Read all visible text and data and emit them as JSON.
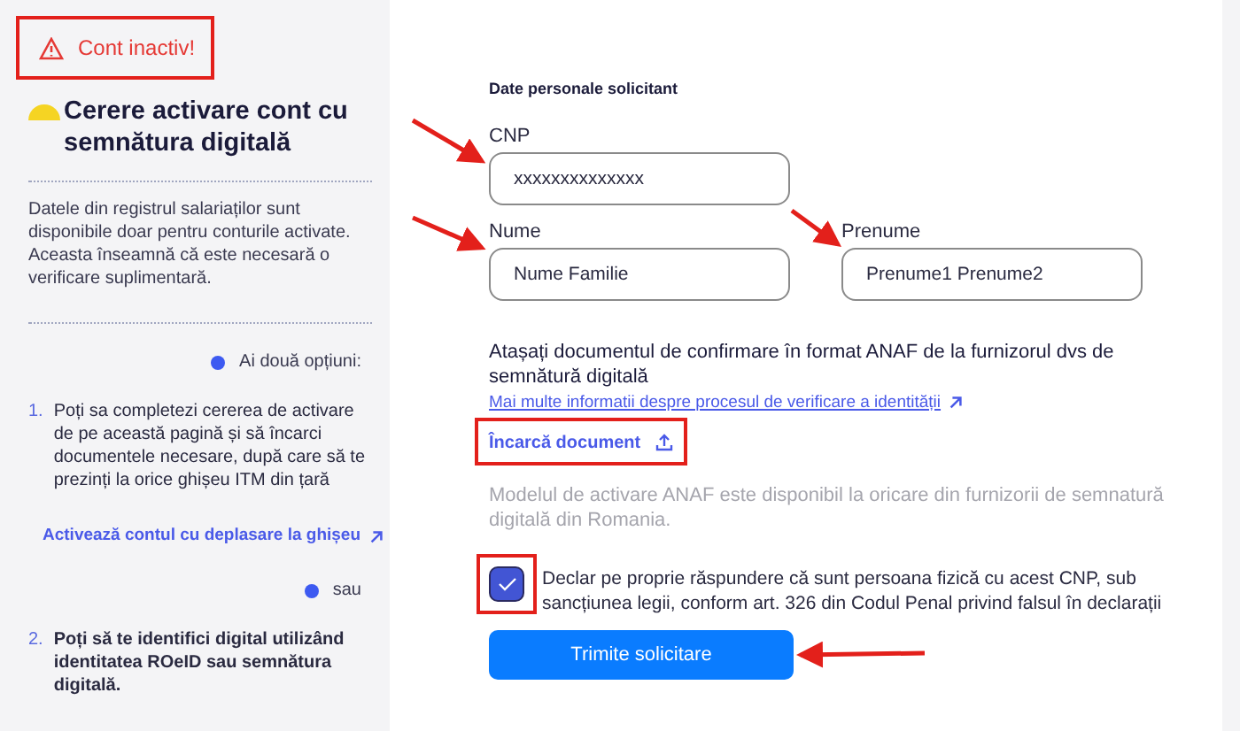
{
  "sidebar": {
    "alert": "Cont inactiv!",
    "title": "Cerere activare cont cu semnătura digitală",
    "intro": "Datele din registrul salariaților sunt disponibile doar pentru conturile activate. Aceasta înseamnă că este necesară o verificare suplimentară.",
    "options_label": "Ai două opțiuni:",
    "option_1": {
      "number": "1.",
      "text": "Poți sa completezi cererea de activare de pe această pagină și să încarci documentele necesare, după care să te prezinți la orice ghișeu ITM din țară"
    },
    "option_link": "Activează contul cu deplasare la ghișeu",
    "separator": "sau",
    "option_2": {
      "number": "2.",
      "text": "Poți să te identifici digital utilizând identitatea ROeID sau semnătura digitală."
    }
  },
  "form": {
    "section_title": "Date personale solicitant",
    "fields": [
      {
        "label": "CNP",
        "value": "xxxxxxxxxxxxxx"
      },
      {
        "label": "Nume",
        "value": "Nume Familie"
      },
      {
        "label": "Prenume",
        "value": "Prenume1 Prenume2"
      }
    ],
    "attach_text": "Atașați documentul de confirmare în format ANAF de la furnizorul dvs de semnătură digitală",
    "info_link": "Mai multe informatii despre procesul de verificare a identității",
    "upload": "Încarcă document",
    "note": "Modelul de activare ANAF este disponibil la oricare din furnizorii de semnatură digitală din Romania.",
    "declaration": {
      "checked": true,
      "text": "Declar pe proprie răspundere că sunt persoana fizică cu acest CNP, sub sancțiunea legii, conform art. 326 din Codul Penal privind falsul în declarații"
    },
    "submit": "Trimite solicitare"
  }
}
